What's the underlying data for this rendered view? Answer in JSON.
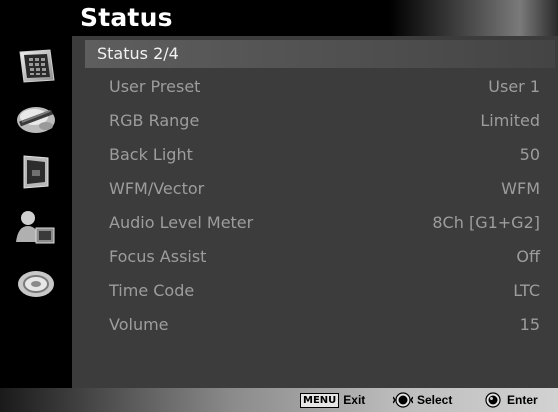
{
  "header": {
    "title": "Status"
  },
  "page": {
    "label": "Status 2/4"
  },
  "sidebar": {
    "icons": [
      "status-panel-icon",
      "color-wheel-icon",
      "display-icon",
      "user-settings-icon",
      "system-icon"
    ]
  },
  "rows": [
    {
      "label": "User Preset",
      "value": "User 1"
    },
    {
      "label": "RGB Range",
      "value": "Limited"
    },
    {
      "label": "Back Light",
      "value": "50"
    },
    {
      "label": "WFM/Vector",
      "value": "WFM"
    },
    {
      "label": "Audio Level Meter",
      "value": "8Ch [G1+G2]"
    },
    {
      "label": "Focus Assist",
      "value": "Off"
    },
    {
      "label": "Time Code",
      "value": "LTC"
    },
    {
      "label": "Volume",
      "value": "15"
    }
  ],
  "footer": {
    "menu_key": "MENU",
    "exit_label": "Exit",
    "select_label": "Select",
    "enter_label": "Enter"
  }
}
